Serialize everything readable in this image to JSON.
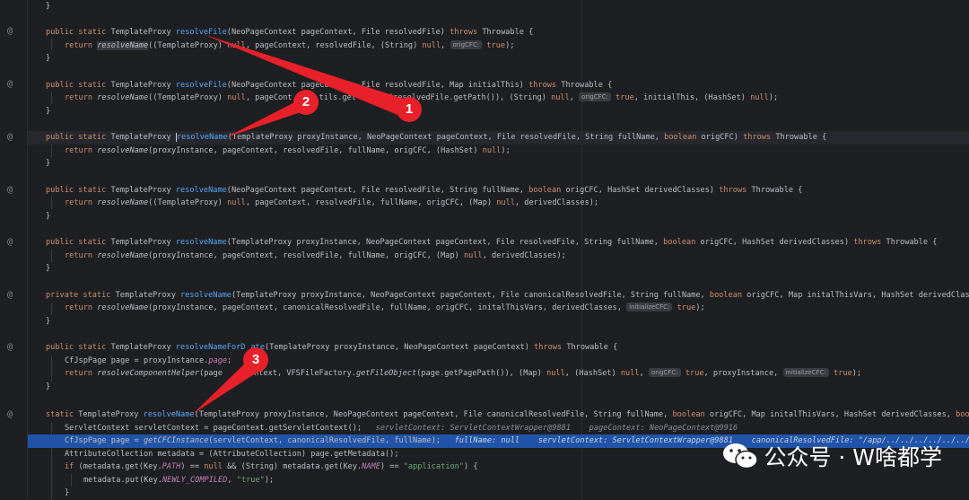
{
  "gutter_markers": {
    "override_icon": "@"
  },
  "code": {
    "l1": "}",
    "l2_mod": "public static",
    "l2_type": " TemplateProxy ",
    "l2_fn": "resolveFile",
    "l2_params": "(NeoPageContext pageContext, File resolvedFile) ",
    "l2_throws": "throws",
    "l2_exc": " Throwable {",
    "l3_return": "return",
    "l3_call": "resolveName",
    "l3_a": "((TemplateProxy) ",
    "l3_null1": "null",
    "l3_b": ", pageContext, resolvedFile, (String) ",
    "l3_null2": "null",
    "l3_hint": "origCFC:",
    "l3_true": "true",
    "l3_c": ");",
    "l4": "}",
    "l5_mod": "public static",
    "l5_type": " TemplateProxy ",
    "l5_fn": "resolveFile",
    "l5_params": "(NeoPageContext pageContext, File resolvedFile, Map initialThis) ",
    "l5_throws": "throws",
    "l5_exc": " Throwable {",
    "l6_return": "return",
    "l6_call": "resolveName",
    "l6_a": "((TemplateProxy) ",
    "l6_null1": "null",
    "l6_b": ", pageCont",
    "l6_b2": "tils.get",
    "l6_b3": "(resolvedFile.getPath()), (String) ",
    "l6_null2": "null",
    "l6_hint": "origCFC:",
    "l6_true": "true",
    "l6_c": ", initialThis, (HashSet) ",
    "l6_null3": "null",
    "l6_d": ");",
    "l7": "}",
    "l8_mod": "public static",
    "l8_type": " TemplateProxy ",
    "l8_fn": "resolveName",
    "l8_params": "(TemplateProxy proxyInstance, NeoPageContext pageContext, File resolvedFile, String fullName, ",
    "l8_bool": "boolean",
    "l8_params2": " origCFC) ",
    "l8_throws": "throws",
    "l8_exc": " Throwable {",
    "l9_return": "return",
    "l9_call": "resolveName",
    "l9_a": "(proxyInstance, pageContext, resolvedFile, fullName, origCFC, (HashSet) ",
    "l9_null": "null",
    "l9_b": ");",
    "l10": "}",
    "l11_mod": "public static",
    "l11_type": " TemplateProxy ",
    "l11_fn": "resolveName",
    "l11_params": "(NeoPageContext pageContext, File resolvedFile, String fullName, ",
    "l11_bool": "boolean",
    "l11_params2": " origCFC, HashSet derivedClasses) ",
    "l11_throws": "throws",
    "l11_exc": " Throwable {",
    "l12_return": "return",
    "l12_call": "resolveName",
    "l12_a": "((TemplateProxy) ",
    "l12_null1": "null",
    "l12_b": ", pageContext, resolvedFile, fullName, origCFC, (Map) ",
    "l12_null2": "null",
    "l12_c": ", derivedClasses);",
    "l13": "}",
    "l14_mod": "public static",
    "l14_type": " TemplateProxy ",
    "l14_fn": "resolveName",
    "l14_params": "(TemplateProxy proxyInstance, NeoPageContext pageContext, File resolvedFile, String fullName, ",
    "l14_bool": "boolean",
    "l14_params2": " origCFC, HashSet derivedClasses) ",
    "l14_throws": "throws",
    "l14_exc": " Throwable {",
    "l15_return": "return",
    "l15_call": "resolveName",
    "l15_a": "(proxyInstance, pageContext, resolvedFile, fullName, origCFC, (Map) ",
    "l15_null": "null",
    "l15_b": ", derivedClasses);",
    "l16": "}",
    "l17_mod": "private static",
    "l17_type": " TemplateProxy ",
    "l17_fn": "resolveName",
    "l17_params": "(TemplateProxy proxyInstance, NeoPageContext pageContext, File canonicalResolvedFile, String fullName, ",
    "l17_bool": "boolean",
    "l17_params2": " origCFC, Map initalThisVars, HashSet derivedClass",
    "l18_return": "return",
    "l18_call": "resolveName",
    "l18_a": "(proxyInstance, pageContext, canonicalResolvedFile, fullName, origCFC, initalThisVars, derivedClasses, ",
    "l18_hint": "initializeCFC:",
    "l18_true": "true",
    "l18_b": ");",
    "l19": "}",
    "l20_mod": "public static",
    "l20_type": " TemplateProxy ",
    "l20_fn": "resolveNameForD",
    "l20_fn2": "ate",
    "l20_params": "(TemplateProxy proxyInstance, NeoPageContext pageContext) ",
    "l20_throws": "throws",
    "l20_exc": " Throwable {",
    "l21_a": "CfJspPage page = proxyInstance.",
    "l21_field": "page",
    "l21_b": ";",
    "l22_return": "return",
    "l22_call": "resolveComponentHelper",
    "l22_a": "(page",
    "l22_b": "ontext, VFSFileFactory.",
    "l22_call2": "getFileObject",
    "l22_c": "(page.getPagePath()), (Map) ",
    "l22_null1": "null",
    "l22_d": ", (HashSet) ",
    "l22_null2": "null",
    "l22_hint1": "origCFC:",
    "l22_true1": "true",
    "l22_e": ", proxyInstance, ",
    "l22_hint2": "initializeCFC:",
    "l22_true2": "true",
    "l22_f": ");",
    "l23": "}",
    "l24_mod": "static",
    "l24_type": " TemplateProxy ",
    "l24_fn": "resolveName",
    "l24_params": "(TemplateProxy proxyInstance, NeoPageContext pageContext, File canonicalResolvedFile, String fullName, ",
    "l24_bool": "boolean",
    "l24_params2": " origCFC, Map initalThisVars, HashSet derivedClasses, ",
    "l24_bool2": "bool",
    "l25_a": "ServletContext servletContext = pageContext.getServletContext();",
    "l25_dbg": "   servletContext: ServletContextWrapper@9881    pageContext: NeoPageContext@9916",
    "l26_a": "CfJspPage page = ",
    "l26_call": "getCFCInstance",
    "l26_b": "(servletContext, canonicalResolvedFile, fullName);",
    "l26_dbg": "   fullName: null    servletContext: ServletContextWrapper@9881    canonicalResolvedFile: \"/app/../../../../../../",
    "l27": "AttributeCollection metadata = (AttributeCollection) page.getMetadata();",
    "l28_if": "if",
    "l28_a": " (metadata.get(Key.",
    "l28_const1": "PATH",
    "l28_b": ") == ",
    "l28_null": "null",
    "l28_c": " && (String) metadata.get(Key.",
    "l28_const2": "NAME",
    "l28_d": ") == ",
    "l28_str": "\"application\"",
    "l28_e": ") {",
    "l29_a": "metadata.put(Key.",
    "l29_const": "NEWLY_COMPILED",
    "l29_b": ", ",
    "l29_str": "\"true\"",
    "l29_c": ");",
    "l30": "}"
  },
  "annotations": {
    "marker1": "1",
    "marker2": "2",
    "marker3": "3",
    "arrow_color": "#e8202a"
  },
  "watermark": {
    "icon": "wechat-icon",
    "text": "公众号 · W啥都学"
  }
}
